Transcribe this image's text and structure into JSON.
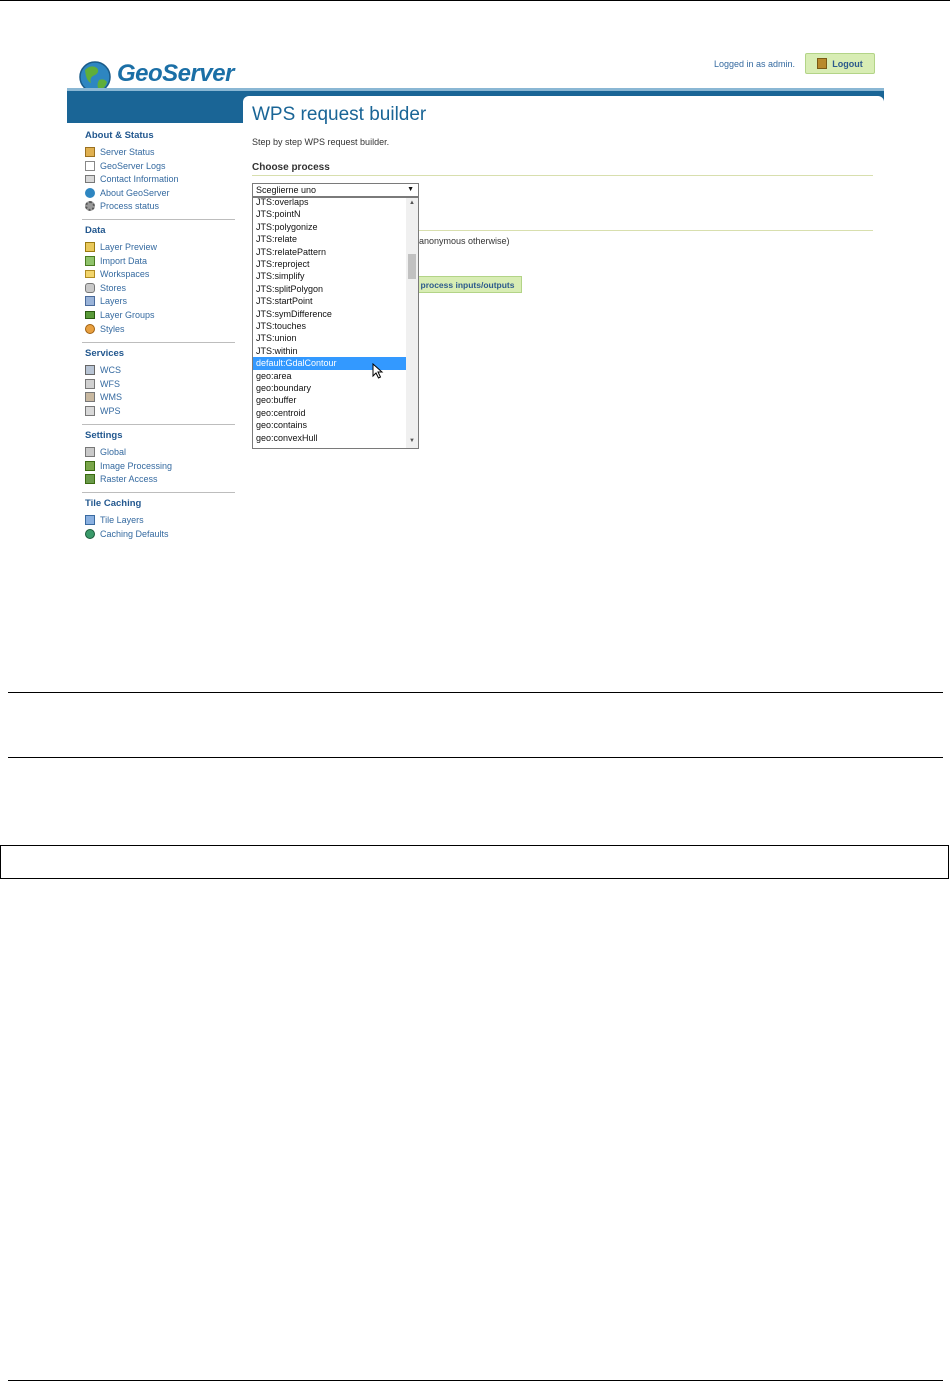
{
  "header": {
    "logo_text": "GeoServer",
    "logged_in_text": "Logged in as admin.",
    "logout_label": "Logout"
  },
  "sidebar": {
    "sections": [
      {
        "title": "About & Status",
        "items": [
          "Server Status",
          "GeoServer Logs",
          "Contact Information",
          "About GeoServer",
          "Process status"
        ]
      },
      {
        "title": "Data",
        "items": [
          "Layer Preview",
          "Import Data",
          "Workspaces",
          "Stores",
          "Layers",
          "Layer Groups",
          "Styles"
        ]
      },
      {
        "title": "Services",
        "items": [
          "WCS",
          "WFS",
          "WMS",
          "WPS"
        ]
      },
      {
        "title": "Settings",
        "items": [
          "Global",
          "Image Processing",
          "Raster Access"
        ]
      },
      {
        "title": "Tile Caching",
        "items": [
          "Tile Layers",
          "Caching Defaults"
        ]
      }
    ]
  },
  "main": {
    "title": "WPS request builder",
    "subtitle": "Step by step WPS request builder.",
    "choose_process_label": "Choose process",
    "select_value": "Sceglierne uno",
    "anonymous_text": "anonymous otherwise)",
    "process_button": "process inputs/outputs",
    "options": [
      "JTS:overlaps",
      "JTS:pointN",
      "JTS:polygonize",
      "JTS:relate",
      "JTS:relatePattern",
      "JTS:reproject",
      "JTS:simplify",
      "JTS:splitPolygon",
      "JTS:startPoint",
      "JTS:symDifference",
      "JTS:touches",
      "JTS:union",
      "JTS:within",
      "default:GdalContour",
      "geo:area",
      "geo:boundary",
      "geo:buffer",
      "geo:centroid",
      "geo:contains",
      "geo:convexHull"
    ],
    "selected_option": "default:GdalContour"
  },
  "colors": {
    "brand_blue": "#1a6596",
    "link_blue": "#356aa0",
    "button_green": "#d8edb4",
    "selected_option": "#3399ff"
  }
}
